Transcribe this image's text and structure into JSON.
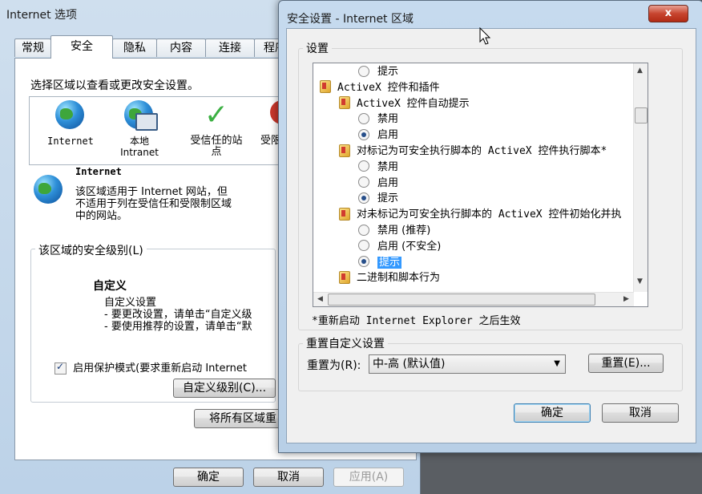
{
  "background_window": {
    "title": "Internet 选项",
    "tabs": [
      "常规",
      "安全",
      "隐私",
      "内容",
      "连接",
      "程序"
    ],
    "instruction": "选择区域以查看或更改安全设置。",
    "zones": [
      "Internet",
      "本地\nIntranet",
      "受信任的站\n点",
      "受限"
    ],
    "zone_title": "Internet",
    "zone_desc": "该区域适用于 Internet 网站，但\n不适用于列在受信任和受限制区域\n中的网站。",
    "security_group_label": "该区域的安全级别(L)",
    "level_name": "自定义",
    "level_lines": [
      "自定义设置",
      "- 要更改设置，请单击“自定义级",
      "- 要使用推荐的设置，请单击“默"
    ],
    "protected_mode_label": "启用保护模式(要求重新启动 Internet",
    "custom_level_button": "自定义级别(C)...",
    "reset_all_button": "将所有区域重",
    "ok": "确定",
    "cancel": "取消",
    "apply": "应用(A)"
  },
  "dialog": {
    "title": "安全设置 - Internet 区域",
    "close": "x",
    "settings_label": "设置",
    "tree": [
      {
        "type": "radio",
        "label": "提示",
        "checked": false,
        "indent": 2
      },
      {
        "type": "folder",
        "label": "ActiveX 控件和插件",
        "indent": 0
      },
      {
        "type": "folder",
        "label": "ActiveX 控件自动提示",
        "indent": 1
      },
      {
        "type": "radio",
        "label": "禁用",
        "checked": false,
        "indent": 2
      },
      {
        "type": "radio",
        "label": "启用",
        "checked": true,
        "indent": 2
      },
      {
        "type": "folder",
        "label": "对标记为可安全执行脚本的 ActiveX 控件执行脚本*",
        "indent": 1
      },
      {
        "type": "radio",
        "label": "禁用",
        "checked": false,
        "indent": 2
      },
      {
        "type": "radio",
        "label": "启用",
        "checked": false,
        "indent": 2
      },
      {
        "type": "radio",
        "label": "提示",
        "checked": true,
        "indent": 2
      },
      {
        "type": "folder",
        "label": "对未标记为可安全执行脚本的 ActiveX 控件初始化并执",
        "indent": 1
      },
      {
        "type": "radio",
        "label": "禁用 (推荐)",
        "checked": false,
        "indent": 2
      },
      {
        "type": "radio",
        "label": "启用 (不安全)",
        "checked": false,
        "indent": 2
      },
      {
        "type": "radio",
        "label": "提示",
        "checked": true,
        "indent": 2,
        "selected": true
      },
      {
        "type": "folder",
        "label": "二进制和脚本行为",
        "indent": 1
      }
    ],
    "restart_note": "*重新启动 Internet Explorer 之后生效",
    "reset_group_label": "重置自定义设置",
    "reset_to_label": "重置为(R):",
    "reset_to_value": "中-高 (默认值)",
    "reset_button": "重置(E)...",
    "ok": "确定",
    "cancel": "取消"
  }
}
